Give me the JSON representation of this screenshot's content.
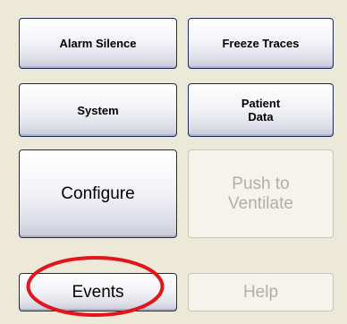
{
  "buttons": {
    "alarm_silence": "Alarm Silence",
    "freeze_traces": "Freeze Traces",
    "system": "System",
    "patient_data": "Patient\nData",
    "configure": "Configure",
    "push_to_ventilate": "Push to\nVentilate",
    "events": "Events",
    "help": "Help"
  },
  "states": {
    "push_to_ventilate_enabled": false,
    "help_enabled": false
  },
  "colors": {
    "panel_background": "#ece9d8",
    "button_border": "#1c2b5c",
    "disabled_text": "#b1b0a8",
    "highlight_ring": "#e3141a"
  }
}
